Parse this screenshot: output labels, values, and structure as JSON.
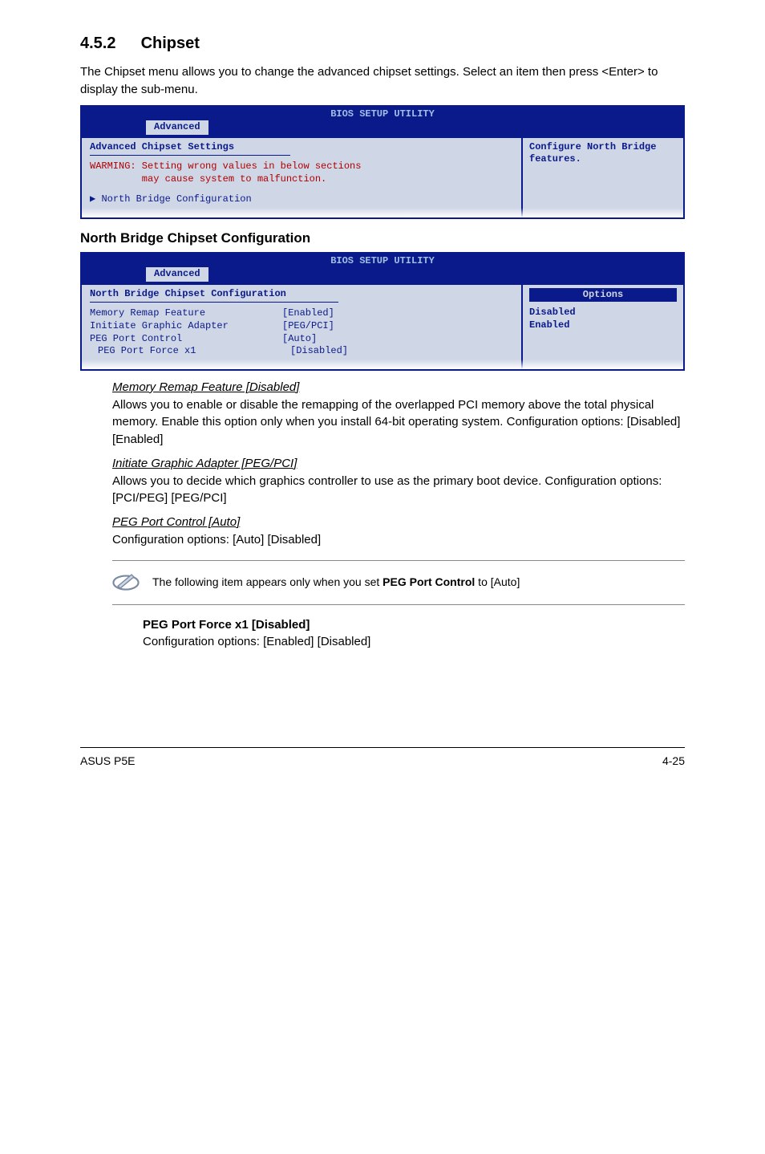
{
  "section": {
    "num": "4.5.2",
    "title": "Chipset"
  },
  "intro": "The Chipset menu allows you to change the advanced chipset settings. Select an item then press <Enter> to display the sub-menu.",
  "bios1": {
    "header": "BIOS SETUP UTILITY",
    "tab": "Advanced",
    "title": "Advanced Chipset Settings",
    "warning": "WARMING: Setting wrong values in below sections\n         may cause system to malfunction.",
    "navitem": "North Bridge Configuration",
    "side": "Configure North Bridge features."
  },
  "subheading": "North Bridge Chipset Configuration",
  "bios2": {
    "header": "BIOS SETUP UTILITY",
    "tab": "Advanced",
    "title": "North Bridge Chipset Configuration",
    "rows": [
      {
        "label": "Memory Remap Feature",
        "value": "[Enabled]"
      },
      {
        "label": "Initiate Graphic Adapter",
        "value": "[PEG/PCI]"
      },
      {
        "label": "PEG Port Control",
        "value": "[Auto]"
      },
      {
        "label": "PEG Port Force x1",
        "value": "[Disabled]",
        "indent": true
      }
    ],
    "side_title": "Options",
    "side_items": [
      "Disabled",
      "Enabled"
    ]
  },
  "explain": {
    "items": [
      {
        "title": "Memory Remap Feature [Disabled]",
        "body": "Allows you to enable or disable the remapping of the overlapped PCI memory above the total physical memory. Enable this option only when you install 64-bit operating system. Configuration options: [Disabled] [Enabled]"
      },
      {
        "title": "Initiate Graphic Adapter [PEG/PCI]",
        "body": "Allows you to decide which graphics controller to use as the primary boot device. Configuration options: [PCI/PEG] [PEG/PCI]"
      },
      {
        "title": "PEG Port Control [Auto]",
        "body": "Configuration options: [Auto] [Disabled]"
      }
    ]
  },
  "note": {
    "text_a": "The following item appears only when you set ",
    "bold": "PEG Port Control",
    "text_b": " to [Auto]"
  },
  "subnote": {
    "title": "PEG Port Force x1 [Disabled]",
    "body": "Configuration options: [Enabled] [Disabled]"
  },
  "footer": {
    "left": "ASUS P5E",
    "right": "4-25"
  }
}
